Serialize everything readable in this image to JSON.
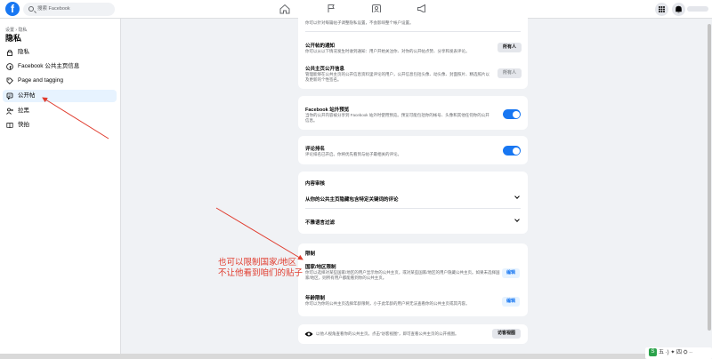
{
  "topbar": {
    "logo_letter": "f",
    "search_placeholder": "搜索 Facebook"
  },
  "sidebar": {
    "breadcrumb": "设置 › 隐私",
    "title": "隐私",
    "items": [
      {
        "label": "隐私",
        "icon": "lock-icon"
      },
      {
        "label": "Facebook 公共主页信息",
        "icon": "facebook-icon"
      },
      {
        "label": "Page and tagging",
        "icon": "tag-icon"
      },
      {
        "label": "公开帖",
        "icon": "post-icon"
      },
      {
        "label": "拉黑",
        "icon": "block-user-icon"
      },
      {
        "label": "快拍",
        "icon": "book-icon"
      }
    ]
  },
  "main": {
    "top_desc": "你可以针对每篇帖子调整隐私设置，不会影响整个帐户设置。",
    "public_notifications": {
      "title": "公开帖的通知",
      "desc": "你可以从以下情况发生时收到通知：用户开始关注你、对你的公开帖点赞、分享和发表评论。",
      "button": "所有人"
    },
    "public_page_info": {
      "title": "公共主页公开信息",
      "desc": "管理能够在公共主页的公开信息资料里评论的用户，公开信息包括头像、动头像、封面照片、精选照片以及更新的个性签名。",
      "button": "所有人"
    },
    "offsite_preview": {
      "title": "Facebook 站外预览",
      "desc": "当你的公开内容被分享到 Facebook 站外时使用预览。预览可能包括你的帐号、头像和其他任何你的公开信息。"
    },
    "comment_ranking": {
      "title": "评论排名",
      "desc": "评论排名已开启。你将优先看到与帖子最相关的评论。"
    },
    "moderation": {
      "heading": "内容审核",
      "items": [
        "从你的公共主页隐藏包含特定关键词的评论",
        "不雅语言过滤"
      ]
    },
    "restrictions": {
      "heading": "限制",
      "country": {
        "title": "国家/地区限制",
        "desc": "你可以选择对某些国家/地区的用户显示你的公共主页，或对某些国家/地区的用户隐藏公共主页。如果未选择国家/地区，则所有用户都能看到你的公共主页。",
        "button": "编辑"
      },
      "age": {
        "title": "年龄限制",
        "desc": "你可以为你的公共主页选择年龄限制，小于此年龄的用户将无法查看你的公共主页或其内容。",
        "button": "编辑"
      }
    },
    "visitor_view": {
      "text": "以他人视角查看你的公共主页。点击“访客视图”，即可查看公共主页的公开视图。",
      "button": "访客视图"
    }
  },
  "annotation": {
    "line1": "也可以限制国家/地区",
    "line2": "不让他看到咱们的贴子"
  },
  "taskbar": {
    "input_method_icon": "S",
    "input_method_text": "五 ·) ✦ 四 ⛭ ··"
  },
  "colors": {
    "accent": "#1877f2",
    "annotation": "#e03c2e"
  }
}
